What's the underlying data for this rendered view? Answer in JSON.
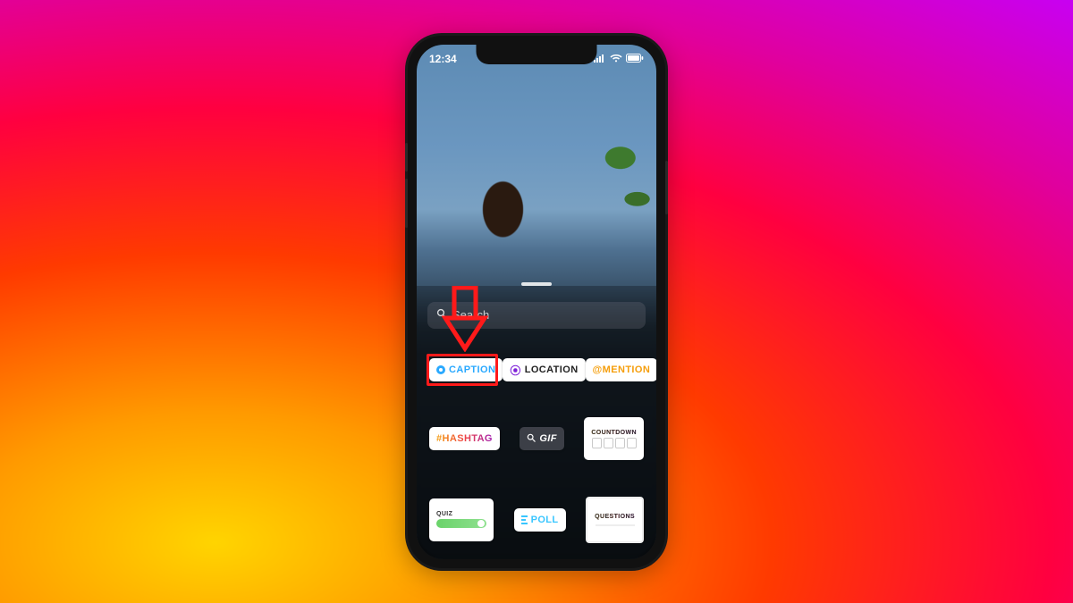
{
  "statusbar": {
    "time": "12:34"
  },
  "search": {
    "placeholder": "Search"
  },
  "stickers": {
    "caption": {
      "label": "CAPTION"
    },
    "location": {
      "label": "LOCATION"
    },
    "mention": {
      "label": "@MENTION"
    },
    "hashtag": {
      "label": "#HASHTAG"
    },
    "gif": {
      "label": "GIF"
    },
    "countdown": {
      "label": "COUNTDOWN"
    },
    "quiz": {
      "label": "QUIZ"
    },
    "poll": {
      "label": "POLL"
    },
    "questions": {
      "label": "QUESTIONS"
    }
  },
  "annotation": {
    "target": "caption"
  }
}
